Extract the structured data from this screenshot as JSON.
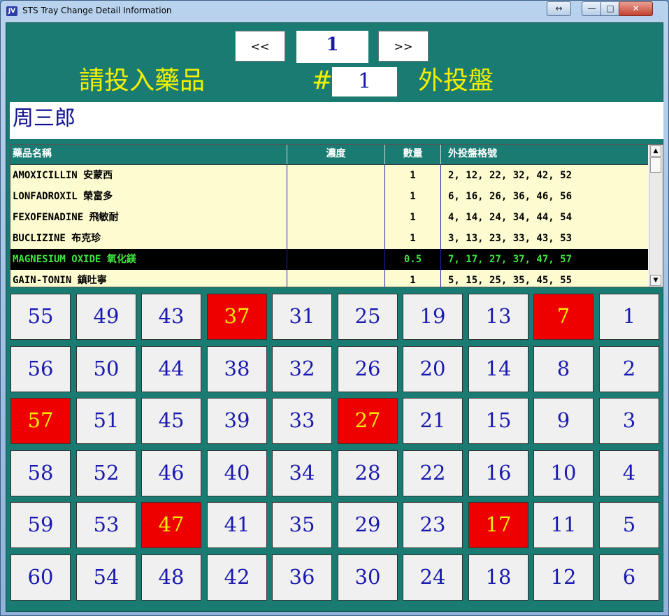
{
  "window": {
    "title": "STS Tray Change Detail Information",
    "app_icon": "JV",
    "controls": {
      "restore": "↔",
      "minimize": "—",
      "maximize": "□",
      "close": "✕"
    }
  },
  "nav": {
    "prev_label": "<<",
    "next_label": ">>",
    "page": "1"
  },
  "instruction": {
    "left_text": "請投入藥品",
    "hash": "#",
    "tray_number": "1",
    "right_text": "外投盤"
  },
  "patient_name": "周三郎",
  "medications": {
    "columns": [
      "藥品名稱",
      "濃度",
      "數量",
      "外投盤格號"
    ],
    "rows": [
      {
        "name": "AMOXICILLIN 安蒙西",
        "strength": "",
        "qty": "1",
        "slots": "2, 12, 22, 32, 42, 52"
      },
      {
        "name": "LONFADROXIL 榮富多",
        "strength": "",
        "qty": "1",
        "slots": "6, 16, 26, 36, 46, 56"
      },
      {
        "name": "FEXOFENADINE 飛敏耐",
        "strength": "",
        "qty": "1",
        "slots": "4, 14, 24, 34, 44, 54"
      },
      {
        "name": "BUCLIZINE 布克珍",
        "strength": "",
        "qty": "1",
        "slots": "3, 13, 23, 33, 43, 53"
      },
      {
        "name": "MAGNESIUM OXIDE 氧化鎂",
        "strength": "",
        "qty": "0.5",
        "slots": "7, 17, 27, 37, 47, 57",
        "selected": true
      },
      {
        "name": "GAIN-TONIN 鎮吐寧",
        "strength": "",
        "qty": "1",
        "slots": "5, 15, 25, 35, 45, 55"
      }
    ],
    "scroll_up": "▲",
    "scroll_down": "▼"
  },
  "tray": {
    "rows": [
      [
        "55",
        "49",
        "43",
        "37",
        "31",
        "25",
        "19",
        "13",
        "7",
        "1"
      ],
      [
        "56",
        "50",
        "44",
        "38",
        "32",
        "26",
        "20",
        "14",
        "8",
        "2"
      ],
      [
        "57",
        "51",
        "45",
        "39",
        "33",
        "27",
        "21",
        "15",
        "9",
        "3"
      ],
      [
        "58",
        "52",
        "46",
        "40",
        "34",
        "28",
        "22",
        "16",
        "10",
        "4"
      ],
      [
        "59",
        "53",
        "47",
        "41",
        "35",
        "29",
        "23",
        "17",
        "11",
        "5"
      ],
      [
        "60",
        "54",
        "48",
        "42",
        "36",
        "30",
        "24",
        "18",
        "12",
        "6"
      ]
    ],
    "highlighted": [
      "7",
      "17",
      "27",
      "37",
      "47",
      "57"
    ],
    "colors": {
      "cell_bg": "#f0f0f0",
      "cell_text": "#1a1ab0",
      "highlight_bg": "#ee0000",
      "highlight_text": "#f5f000"
    }
  },
  "colors": {
    "panel_bg": "#1a7b72",
    "instruction_text": "#f0f000",
    "selected_row_bg": "#000000",
    "selected_row_text": "#3fe63f"
  }
}
